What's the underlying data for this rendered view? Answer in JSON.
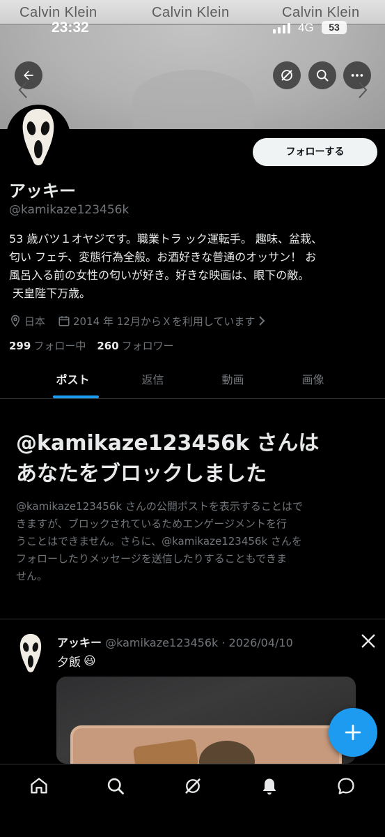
{
  "banner": {
    "brand_texts": [
      "Calvin Klein",
      "Calvin Klein",
      "Calvin Klein"
    ]
  },
  "status_bar": {
    "time": "23:32",
    "network": "4G",
    "battery": "53"
  },
  "profile": {
    "follow_button": "フォローする",
    "name": "アッキー",
    "handle": "@kamikaze123456k",
    "bio_lines": [
      "53 歳バツ１オヤジです。職業トラ ック運転手。 趣味、盆栽、",
      "匂い フェチ、変態行為全般。お酒好きな普通のオッサン！ お",
      "風呂入る前の女性の匂いが好き。好きな映画は、眼下の敵。",
      " 天皇陛下万歳。"
    ],
    "location": "日本",
    "joined": "2014 年 12月からＸを利用しています",
    "following_count": "299",
    "following_label": "フォロー中",
    "followers_count": "260",
    "followers_label": "フォロワー"
  },
  "tabs": [
    {
      "label": "ポスト",
      "active": true
    },
    {
      "label": "返信",
      "active": false
    },
    {
      "label": "動画",
      "active": false
    },
    {
      "label": "画像",
      "active": false
    }
  ],
  "blocked": {
    "title_lines": [
      "@kamikaze123456k さんは",
      "あなたをブロックしました"
    ],
    "description_lines": [
      "@kamikaze123456k さんの公開ポストを表示することはで",
      "きますが、ブロックされているためエンゲージメントを行",
      "うことはできません。さらに、@kamikaze123456k さんを",
      "フォローしたりメッセージを送信したりすることもできま",
      "せん。"
    ]
  },
  "post": {
    "author": "アッキー",
    "meta": " @kamikaze123456k · 2026/04/10",
    "text": "夕飯",
    "emoji": "😃"
  },
  "icons": {
    "back": "arrow-left-icon",
    "grok": "grok-icon",
    "search": "search-icon",
    "more": "more-icon",
    "location": "location-pin-icon",
    "calendar": "calendar-icon",
    "compose": "plus-icon",
    "x_logo": "x-logo-icon",
    "nav": [
      "home-icon",
      "search-icon",
      "grok-icon",
      "bell-icon",
      "messages-icon"
    ]
  },
  "colors": {
    "accent": "#1d9bf0",
    "background": "#000000",
    "secondary_text": "#71767b"
  }
}
